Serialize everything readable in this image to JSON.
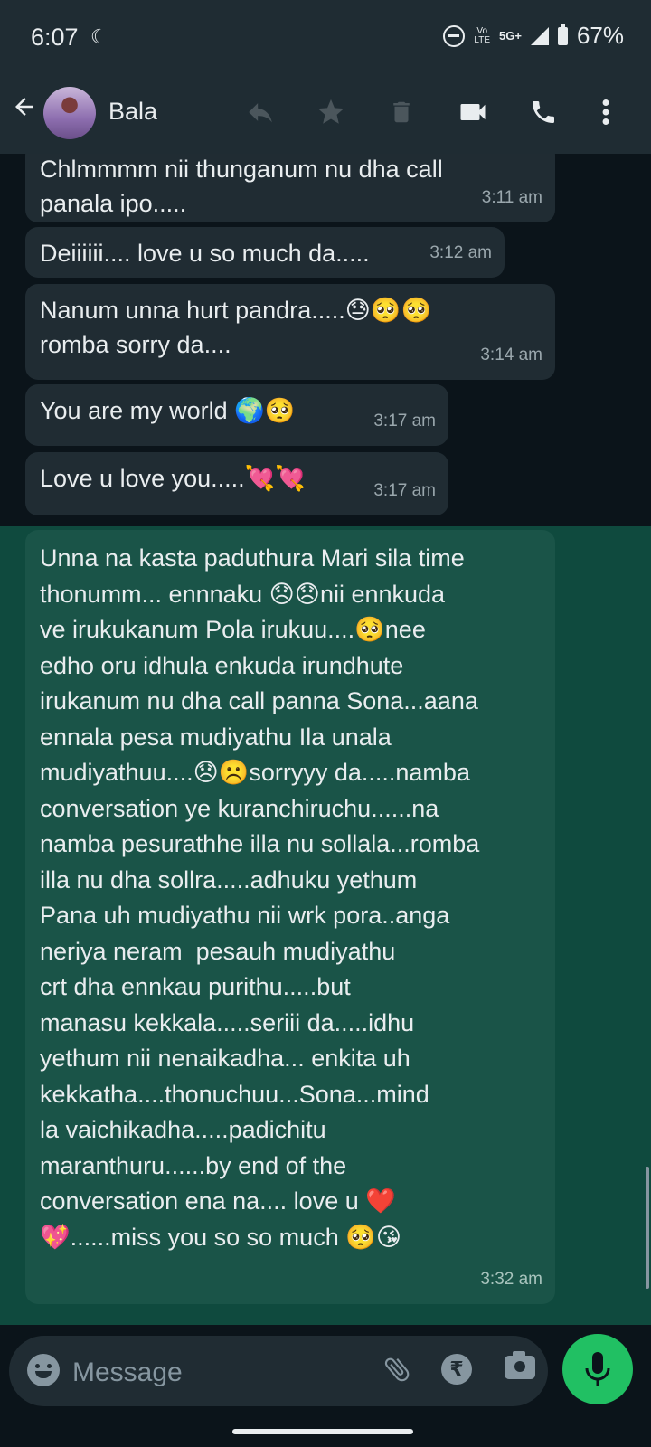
{
  "status_bar": {
    "time": "6:07",
    "network_top": "Vo",
    "network_bottom": "LTE",
    "net_type": "5G+",
    "battery": "67%"
  },
  "header": {
    "contact_name": "Bala",
    "icons": [
      "back-arrow-icon",
      "reply-icon",
      "star-icon",
      "delete-icon",
      "video-call-icon",
      "voice-call-icon",
      "more-options-icon"
    ]
  },
  "messages": [
    {
      "text": "Chlmmmm nii thunganum nu dha call\npanala ipo.....",
      "time": "3:11 am"
    },
    {
      "text": "Deiiiiii.... love u so much da.....",
      "time": "3:12 am"
    },
    {
      "text": "Nanum unna hurt pandra.....😓🥺🥺\nromba sorry da....",
      "time": "3:14 am"
    },
    {
      "text": "You are my world 🌍🥺",
      "time": "3:17 am"
    },
    {
      "text": "Love u love you.....💘💘",
      "time": "3:17 am"
    },
    {
      "text": "Unna na kasta paduthura Mari sila time\nthonumm... ennnaku 😞😞nii ennkuda\nve irukukanum Pola irukuu....🥺nee\nedho oru idhula enkuda irundhute\nirukanum nu dha call panna Sona...aana\nennala pesa mudiyathu Ila unala\nmudiyathuu....😞☹️sorryyy da.....namba\nconversation ye kuranchiruchu......na\nnamba pesurathhe illa nu sollala...romba\nilla nu dha sollra.....adhuku yethum\nPana uh mudiyathu nii wrk pora..anga\nneriya neram  pesauh mudiyathu\ncrt dha ennkau purithu.....but\nmanasu kekkala.....seriii da.....idhu\nyethum nii nenaikadha... enkita uh\nkekkatha....thonuchuu...Sona...mind\nla vaichikadha.....padichitu\nmaranthuru......by end of the\nconversation ena na.... love u ❤️\n💖......miss you so so much 🥺😘",
      "time": "3:32 am"
    }
  ],
  "input_bar": {
    "placeholder": "Message",
    "icons": [
      "emoji-icon",
      "attach-icon",
      "payment-icon",
      "camera-icon",
      "mic-icon"
    ]
  }
}
